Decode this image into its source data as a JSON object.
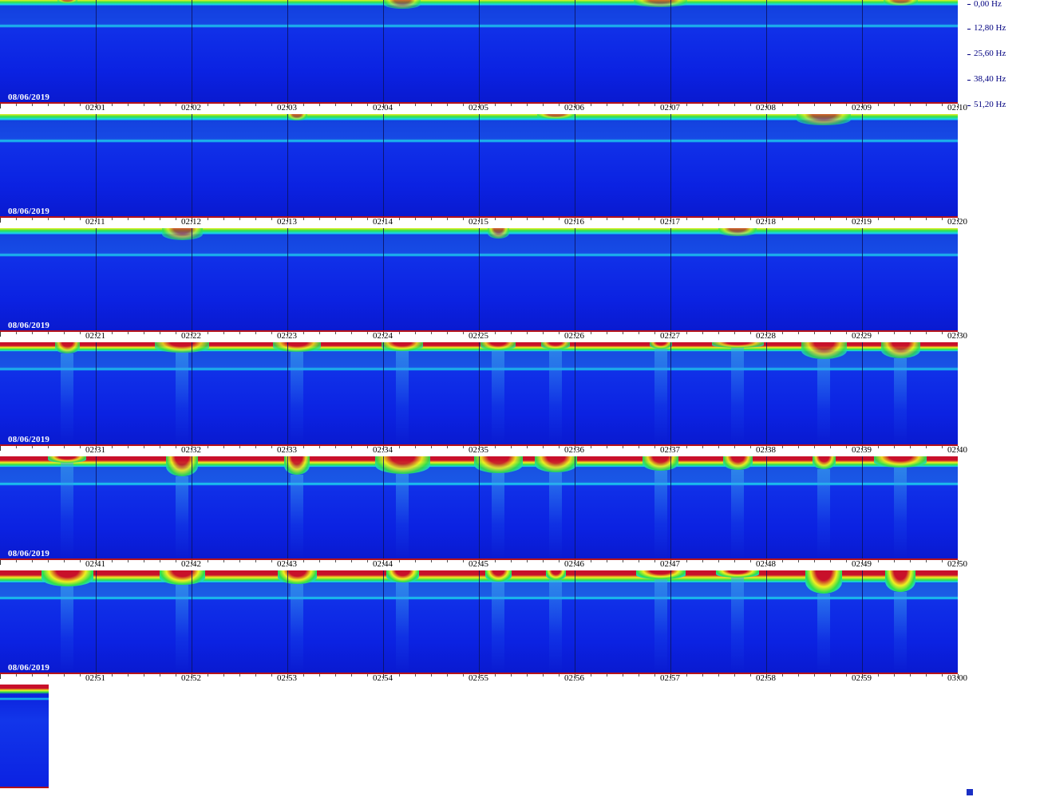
{
  "freq_axis": [
    "0,00 Hz",
    "12,80 Hz",
    "25,60 Hz",
    "38,40 Hz",
    "51,20 Hz"
  ],
  "rows": [
    {
      "date": "08/06/2019",
      "times": [
        "02:01",
        "02:02",
        "02:03",
        "02:04",
        "02:05",
        "02:06",
        "02:07",
        "02:08",
        "02:09",
        "02:10"
      ],
      "intensity": 0.15
    },
    {
      "date": "08/06/2019",
      "times": [
        "02:11",
        "02:12",
        "02:13",
        "02:14",
        "02:15",
        "02:16",
        "02:17",
        "02:18",
        "02:19",
        "02:20"
      ],
      "intensity": 0.25
    },
    {
      "date": "08/06/2019",
      "times": [
        "02:21",
        "02:22",
        "02:23",
        "02:24",
        "02:25",
        "02:26",
        "02:27",
        "02:28",
        "02:29",
        "02:30"
      ],
      "intensity": 0.3
    },
    {
      "date": "08/06/2019",
      "times": [
        "02:31",
        "02:32",
        "02:33",
        "02:34",
        "02:35",
        "02:36",
        "02:37",
        "02:38",
        "02:39",
        "02:40"
      ],
      "intensity": 0.6
    },
    {
      "date": "08/06/2019",
      "times": [
        "02:41",
        "02:42",
        "02:43",
        "02:44",
        "02:45",
        "02:46",
        "02:47",
        "02:48",
        "02:49",
        "02:50"
      ],
      "intensity": 0.8
    },
    {
      "date": "08/06/2019",
      "times": [
        "02:51",
        "02:52",
        "02:53",
        "02:54",
        "02:55",
        "02:56",
        "02:57",
        "02:58",
        "02:59",
        "03:00"
      ],
      "intensity": 1.0
    }
  ],
  "colors": {
    "background": "#0b22e2",
    "cyan": "#19d6ee",
    "green": "#2fe04a",
    "yellow": "#f0f020",
    "red": "#c8102a",
    "grid": "#0b1460",
    "axis_line": "#b3121b"
  }
}
